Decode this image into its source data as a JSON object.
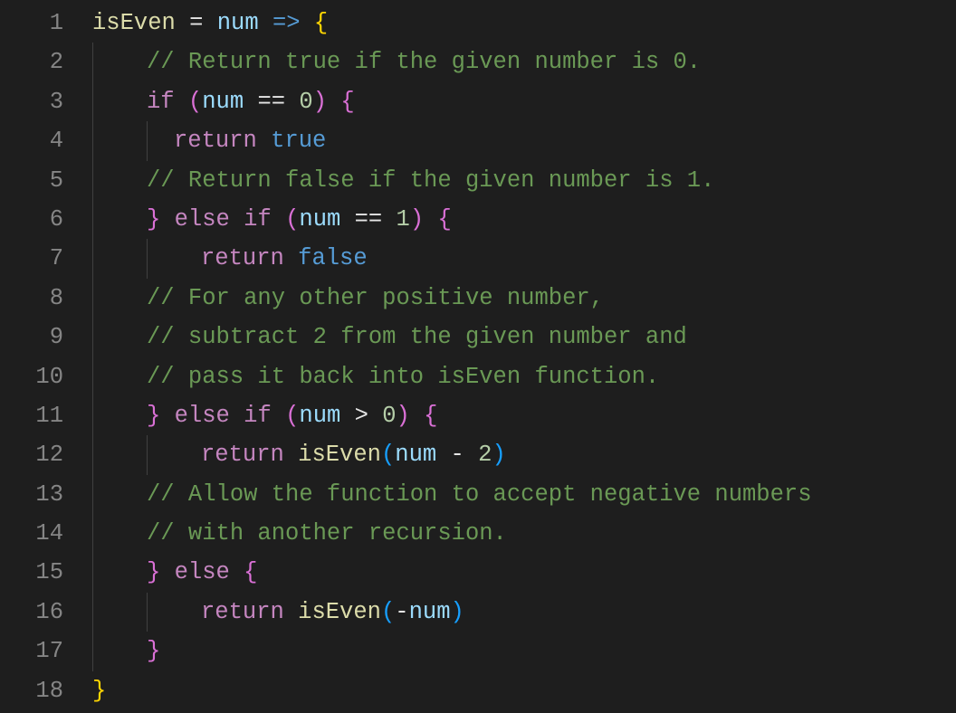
{
  "editor": {
    "lineNumbers": [
      "1",
      "2",
      "3",
      "4",
      "5",
      "6",
      "7",
      "8",
      "9",
      "10",
      "11",
      "12",
      "13",
      "14",
      "15",
      "16",
      "17",
      "18"
    ],
    "indentUnitPx": 60,
    "guideOffsetsPx": [
      0,
      60,
      120
    ],
    "lines": [
      {
        "indent": 0,
        "guides": [],
        "tokens": [
          {
            "cls": "t-ident",
            "t": "isEven"
          },
          {
            "cls": "t-plain",
            "t": " = "
          },
          {
            "cls": "t-param",
            "t": "num"
          },
          {
            "cls": "t-plain",
            "t": " "
          },
          {
            "cls": "t-arrow",
            "t": "=>"
          },
          {
            "cls": "t-plain",
            "t": " "
          },
          {
            "cls": "t-brace",
            "t": "{"
          }
        ]
      },
      {
        "indent": 1,
        "guides": [
          0
        ],
        "tokens": [
          {
            "cls": "t-comment",
            "t": "// Return true if the given number is 0."
          }
        ]
      },
      {
        "indent": 1,
        "guides": [
          0
        ],
        "tokens": [
          {
            "cls": "t-ctrl",
            "t": "if"
          },
          {
            "cls": "t-plain",
            "t": " "
          },
          {
            "cls": "t-brace-p",
            "t": "("
          },
          {
            "cls": "t-param",
            "t": "num"
          },
          {
            "cls": "t-plain",
            "t": " == "
          },
          {
            "cls": "t-num",
            "t": "0"
          },
          {
            "cls": "t-brace-p",
            "t": ")"
          },
          {
            "cls": "t-plain",
            "t": " "
          },
          {
            "cls": "t-brace-p",
            "t": "{"
          }
        ]
      },
      {
        "indent": 1,
        "guides": [
          0,
          1
        ],
        "extraPadPx": 30,
        "tokens": [
          {
            "cls": "t-ctrl",
            "t": "return"
          },
          {
            "cls": "t-plain",
            "t": " "
          },
          {
            "cls": "t-kw-decl",
            "t": "true"
          }
        ]
      },
      {
        "indent": 1,
        "guides": [
          0
        ],
        "tokens": [
          {
            "cls": "t-comment",
            "t": "// Return false if the given number is 1."
          }
        ]
      },
      {
        "indent": 1,
        "guides": [
          0
        ],
        "tokens": [
          {
            "cls": "t-brace-p",
            "t": "}"
          },
          {
            "cls": "t-plain",
            "t": " "
          },
          {
            "cls": "t-ctrl",
            "t": "else"
          },
          {
            "cls": "t-plain",
            "t": " "
          },
          {
            "cls": "t-ctrl",
            "t": "if"
          },
          {
            "cls": "t-plain",
            "t": " "
          },
          {
            "cls": "t-brace-p",
            "t": "("
          },
          {
            "cls": "t-param",
            "t": "num"
          },
          {
            "cls": "t-plain",
            "t": " == "
          },
          {
            "cls": "t-num",
            "t": "1"
          },
          {
            "cls": "t-brace-p",
            "t": ")"
          },
          {
            "cls": "t-plain",
            "t": " "
          },
          {
            "cls": "t-brace-p",
            "t": "{"
          }
        ]
      },
      {
        "indent": 2,
        "guides": [
          0,
          1
        ],
        "tokens": [
          {
            "cls": "t-ctrl",
            "t": "return"
          },
          {
            "cls": "t-plain",
            "t": " "
          },
          {
            "cls": "t-kw-decl",
            "t": "false"
          }
        ]
      },
      {
        "indent": 1,
        "guides": [
          0
        ],
        "tokens": [
          {
            "cls": "t-comment",
            "t": "// For any other positive number,"
          }
        ]
      },
      {
        "indent": 1,
        "guides": [
          0
        ],
        "tokens": [
          {
            "cls": "t-comment",
            "t": "// subtract 2 from the given number and"
          }
        ]
      },
      {
        "indent": 1,
        "guides": [
          0
        ],
        "tokens": [
          {
            "cls": "t-comment",
            "t": "// pass it back into isEven function."
          }
        ]
      },
      {
        "indent": 1,
        "guides": [
          0
        ],
        "tokens": [
          {
            "cls": "t-brace-p",
            "t": "}"
          },
          {
            "cls": "t-plain",
            "t": " "
          },
          {
            "cls": "t-ctrl",
            "t": "else"
          },
          {
            "cls": "t-plain",
            "t": " "
          },
          {
            "cls": "t-ctrl",
            "t": "if"
          },
          {
            "cls": "t-plain",
            "t": " "
          },
          {
            "cls": "t-brace-p",
            "t": "("
          },
          {
            "cls": "t-param",
            "t": "num"
          },
          {
            "cls": "t-plain",
            "t": " > "
          },
          {
            "cls": "t-num",
            "t": "0"
          },
          {
            "cls": "t-brace-p",
            "t": ")"
          },
          {
            "cls": "t-plain",
            "t": " "
          },
          {
            "cls": "t-brace-p",
            "t": "{"
          }
        ]
      },
      {
        "indent": 2,
        "guides": [
          0,
          1
        ],
        "tokens": [
          {
            "cls": "t-ctrl",
            "t": "return"
          },
          {
            "cls": "t-plain",
            "t": " "
          },
          {
            "cls": "t-call",
            "t": "isEven"
          },
          {
            "cls": "t-brace-b",
            "t": "("
          },
          {
            "cls": "t-param",
            "t": "num"
          },
          {
            "cls": "t-plain",
            "t": " - "
          },
          {
            "cls": "t-num",
            "t": "2"
          },
          {
            "cls": "t-brace-b",
            "t": ")"
          }
        ]
      },
      {
        "indent": 1,
        "guides": [
          0
        ],
        "tokens": [
          {
            "cls": "t-comment",
            "t": "// Allow the function to accept negative numbers"
          }
        ]
      },
      {
        "indent": 1,
        "guides": [
          0
        ],
        "tokens": [
          {
            "cls": "t-comment",
            "t": "// with another recursion."
          }
        ]
      },
      {
        "indent": 1,
        "guides": [
          0
        ],
        "tokens": [
          {
            "cls": "t-brace-p",
            "t": "}"
          },
          {
            "cls": "t-plain",
            "t": " "
          },
          {
            "cls": "t-ctrl",
            "t": "else"
          },
          {
            "cls": "t-plain",
            "t": " "
          },
          {
            "cls": "t-brace-p",
            "t": "{"
          }
        ]
      },
      {
        "indent": 2,
        "guides": [
          0,
          1
        ],
        "tokens": [
          {
            "cls": "t-ctrl",
            "t": "return"
          },
          {
            "cls": "t-plain",
            "t": " "
          },
          {
            "cls": "t-call",
            "t": "isEven"
          },
          {
            "cls": "t-brace-b",
            "t": "("
          },
          {
            "cls": "t-plain",
            "t": "-"
          },
          {
            "cls": "t-param",
            "t": "num"
          },
          {
            "cls": "t-brace-b",
            "t": ")"
          }
        ]
      },
      {
        "indent": 1,
        "guides": [
          0
        ],
        "tokens": [
          {
            "cls": "t-brace-p",
            "t": "}"
          }
        ]
      },
      {
        "indent": 0,
        "guides": [],
        "tokens": [
          {
            "cls": "t-brace",
            "t": "}"
          }
        ]
      }
    ]
  }
}
